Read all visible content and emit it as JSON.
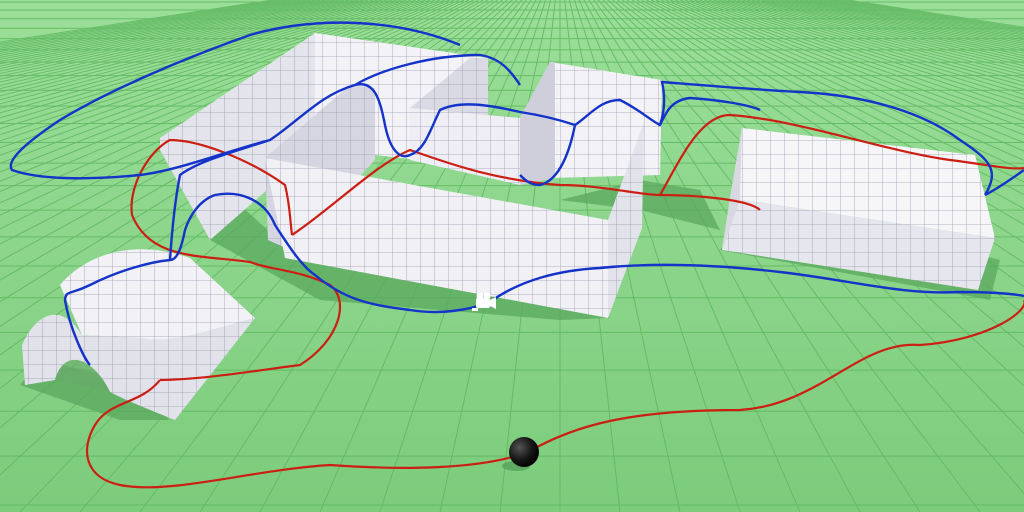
{
  "scene": {
    "ground_color": "#84d684",
    "grid_color": "#5fb85f",
    "block_face_light": "#f2f2f6",
    "block_face_mid": "#dcdce6",
    "block_face_dark": "#c4c4d2",
    "block_grid_color": "#9a9aae",
    "shadow_color": "#4f9a56",
    "paths": [
      {
        "name": "camera-path",
        "color": "#1433c8"
      },
      {
        "name": "ball-path",
        "color": "#cc1f14"
      }
    ],
    "markers": [
      {
        "name": "camera-marker-icon",
        "icon": "camera-icon"
      },
      {
        "name": "ball-marker",
        "icon": "ball"
      }
    ]
  }
}
